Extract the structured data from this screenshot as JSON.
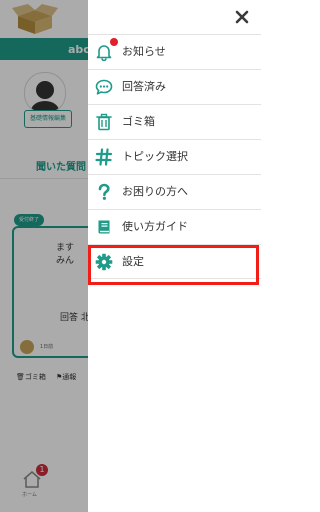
{
  "background": {
    "header_username": "abc",
    "edit_profile_label": "基礎情報編集",
    "question_tab_label": "聞いた質問",
    "card": {
      "badge": "受付終了",
      "line1": "ます",
      "line2": "みん",
      "answer": "回答 北",
      "date": "1日前"
    },
    "trash_link": "ゴミ箱",
    "report_link": "通報",
    "home_badge": "1",
    "home_label": "ホーム"
  },
  "drawer": {
    "close_icon": "close-icon",
    "menu": [
      {
        "label": "お知らせ",
        "icon": "bell-icon",
        "has_notification_dot": true
      },
      {
        "label": "回答済み",
        "icon": "chat-bubble-icon"
      },
      {
        "label": "ゴミ箱",
        "icon": "trash-icon"
      },
      {
        "label": "トピック選択",
        "icon": "hashtag-icon"
      },
      {
        "label": "お困りの方へ",
        "icon": "question-mark-icon"
      },
      {
        "label": "使い方ガイド",
        "icon": "book-icon"
      },
      {
        "label": "設定",
        "icon": "gear-icon",
        "highlighted": true
      }
    ]
  },
  "colors": {
    "accent": "#1e9b89",
    "highlight_border": "#f21d17",
    "notification_dot": "#e1202b"
  }
}
